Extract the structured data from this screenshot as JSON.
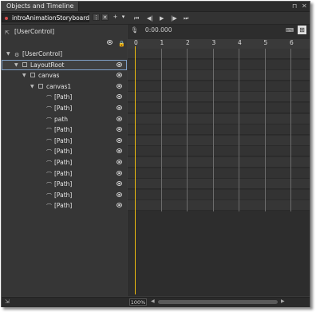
{
  "title": "Objects and Timeline",
  "window_controls": [
    "pin-icon",
    "close-icon"
  ],
  "storyboard": {
    "name": "introAnimationStoryboard",
    "buttons": [
      "storyboard-options-icon",
      "close-storyboard-icon",
      "add-storyboard-icon",
      "dropdown-icon"
    ]
  },
  "playback": {
    "buttons": [
      "go-to-first-frame-icon",
      "previous-frame-icon",
      "play-icon",
      "next-frame-icon",
      "go-to-last-frame-icon"
    ],
    "time": "0:00.000"
  },
  "scope": {
    "label": "[UserControl]"
  },
  "tree": [
    {
      "label": "[UserControl]",
      "indent": 0,
      "expanded": true,
      "icon": "usercontrol-icon",
      "eye": false
    },
    {
      "label": "LayoutRoot",
      "indent": 1,
      "expanded": true,
      "icon": "grid-icon",
      "eye": true,
      "selected": true
    },
    {
      "label": "canvas",
      "indent": 2,
      "expanded": true,
      "icon": "canvas-icon",
      "eye": true
    },
    {
      "label": "canvas1",
      "indent": 3,
      "expanded": true,
      "icon": "canvas-icon",
      "eye": true
    },
    {
      "label": "[Path]",
      "indent": 4,
      "icon": "path-icon",
      "eye": true
    },
    {
      "label": "[Path]",
      "indent": 4,
      "icon": "path-icon",
      "eye": true
    },
    {
      "label": "path",
      "indent": 4,
      "icon": "path-icon",
      "eye": true
    },
    {
      "label": "[Path]",
      "indent": 4,
      "icon": "path-icon",
      "eye": true
    },
    {
      "label": "[Path]",
      "indent": 4,
      "icon": "path-icon",
      "eye": true
    },
    {
      "label": "[Path]",
      "indent": 4,
      "icon": "path-icon",
      "eye": true
    },
    {
      "label": "[Path]",
      "indent": 4,
      "icon": "path-icon",
      "eye": true
    },
    {
      "label": "[Path]",
      "indent": 4,
      "icon": "path-icon",
      "eye": true
    },
    {
      "label": "[Path]",
      "indent": 4,
      "icon": "path-icon",
      "eye": true
    },
    {
      "label": "[Path]",
      "indent": 4,
      "icon": "path-icon",
      "eye": true
    },
    {
      "label": "[Path]",
      "indent": 4,
      "icon": "path-icon",
      "eye": true
    }
  ],
  "ruler": {
    "ticks": [
      "0",
      "1",
      "2",
      "3",
      "4",
      "5",
      "6"
    ],
    "playhead_seconds": 0
  },
  "zoom": "100%",
  "colors": {
    "playhead": "#e8b80f",
    "selection": "#7fa0c8",
    "storyboard_dot": "#d24b4b"
  }
}
